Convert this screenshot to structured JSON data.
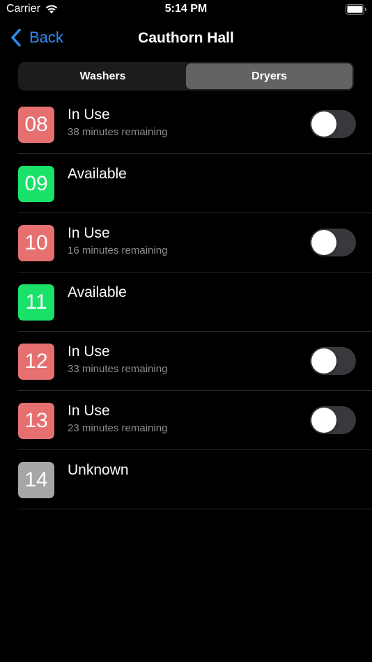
{
  "status_bar": {
    "carrier": "Carrier",
    "time": "5:14 PM",
    "wifi_icon": "wifi-icon",
    "battery_icon": "battery-icon"
  },
  "nav": {
    "back_label": "Back",
    "back_icon": "chevron-left-icon",
    "title": "Cauthorn Hall",
    "accent_color": "#2f8cf6"
  },
  "segmented": {
    "options": [
      "Washers",
      "Dryers"
    ],
    "selected": "Dryers"
  },
  "colors": {
    "in_use": "#e5706f",
    "available": "#19e16a",
    "unknown": "#a6a6a6"
  },
  "machines": [
    {
      "number": "08",
      "status": "In Use",
      "detail": "38 minutes remaining",
      "notify_toggle": false
    },
    {
      "number": "09",
      "status": "Available",
      "detail": ""
    },
    {
      "number": "10",
      "status": "In Use",
      "detail": "16 minutes remaining",
      "notify_toggle": false
    },
    {
      "number": "11",
      "status": "Available",
      "detail": ""
    },
    {
      "number": "12",
      "status": "In Use",
      "detail": "33 minutes remaining",
      "notify_toggle": false
    },
    {
      "number": "13",
      "status": "In Use",
      "detail": "23 minutes remaining",
      "notify_toggle": false
    },
    {
      "number": "14",
      "status": "Unknown",
      "detail": ""
    }
  ]
}
